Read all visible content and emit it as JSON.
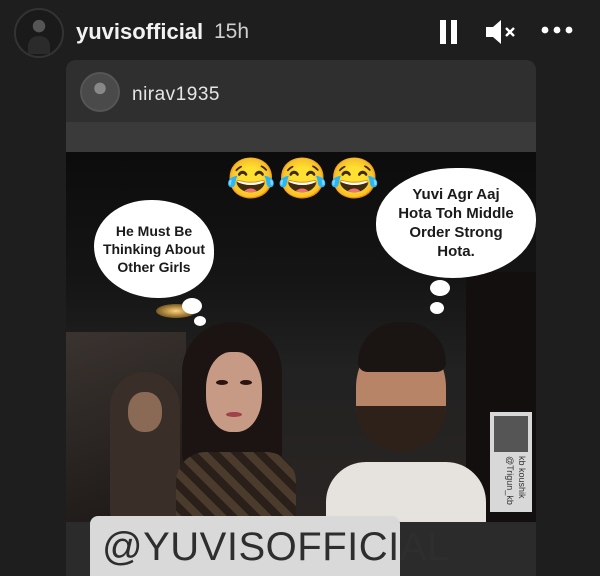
{
  "story": {
    "username": "yuvisofficial",
    "time_ago": "15h",
    "icons": {
      "pause": "pause-icon",
      "mute": "speaker-muted-icon",
      "more": "more-options-icon"
    }
  },
  "shared_post": {
    "username": "nirav1935",
    "emojis": "😂😂😂",
    "bubble_left": "He Must Be Thinking About Other Girls",
    "bubble_right": "Yuvi Agr Aaj Hota Toh Middle Order Strong Hota.",
    "watermark": {
      "line1": "kb koushik",
      "line2": "@Trigun_kb"
    }
  },
  "mention_sticker": "@YUVISOFFICIAL"
}
